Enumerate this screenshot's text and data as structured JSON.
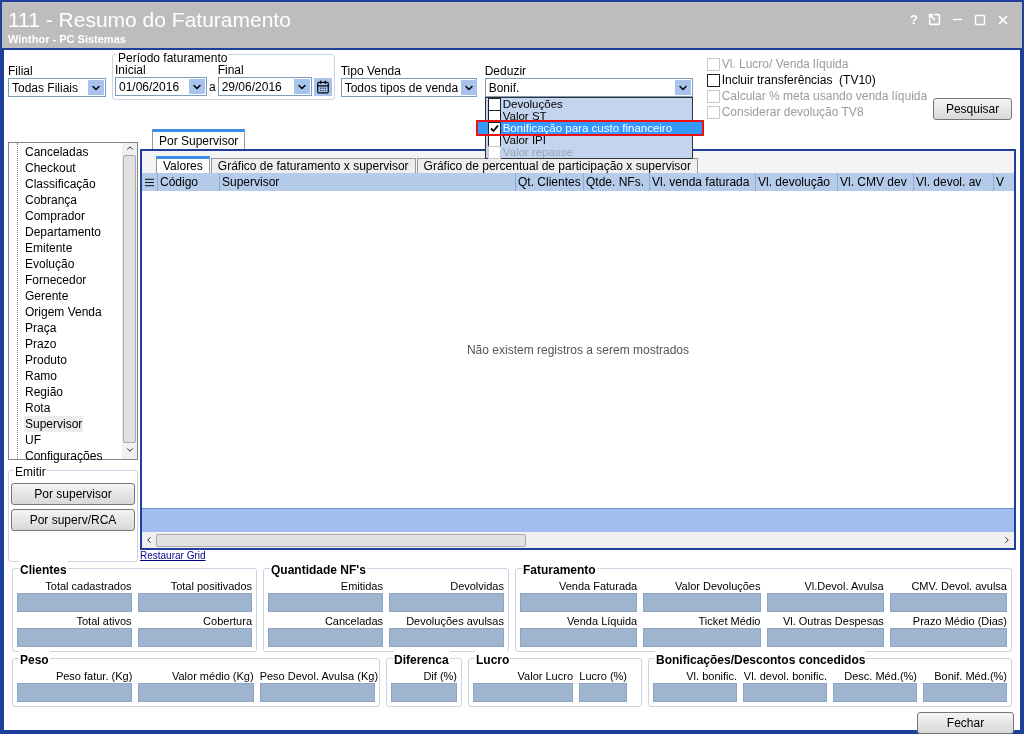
{
  "window": {
    "title": "111 - Resumo do Faturamento",
    "subtitle": "Winthor - PC Sistemas",
    "help": "?"
  },
  "filters": {
    "filial": {
      "label": "Filial",
      "value": "Todas Filiais"
    },
    "periodo": {
      "legend": "Período faturamento",
      "inicial_label": "Inicial",
      "inicial": "01/06/2016",
      "separator": "a",
      "final_label": "Final",
      "final": "29/06/2016"
    },
    "tipo_venda": {
      "label": "Tipo Venda",
      "value": "Todos tipos de venda"
    },
    "deduzir": {
      "label": "Deduzir",
      "value": "Bonif.",
      "options": [
        {
          "label": "Devoluções",
          "checked": false,
          "selected": false,
          "disabled": false
        },
        {
          "label": "Valor ST",
          "checked": false,
          "selected": false,
          "disabled": false
        },
        {
          "label": "Bonificação para custo financeiro",
          "checked": true,
          "selected": true,
          "disabled": false
        },
        {
          "label": "Valor IPI",
          "checked": false,
          "selected": false,
          "disabled": false
        },
        {
          "label": "Valor repasse",
          "checked": false,
          "selected": false,
          "disabled": true
        }
      ]
    }
  },
  "options": [
    {
      "label": "Vl. Lucro/ Venda líquida",
      "checked": false,
      "disabled": true
    },
    {
      "label": "Incluir transferências  (TV10)",
      "checked": false,
      "disabled": false
    },
    {
      "label": "Calcular % meta usando venda líquida",
      "checked": false,
      "disabled": true
    },
    {
      "label": "Considerar devolução TV8",
      "checked": false,
      "disabled": true
    }
  ],
  "search_button": "Pesquisar",
  "tree": {
    "items": [
      {
        "label": "Canceladas",
        "selected": false
      },
      {
        "label": "Checkout",
        "selected": false
      },
      {
        "label": "Classificação",
        "selected": false
      },
      {
        "label": "Cobrança",
        "selected": false
      },
      {
        "label": "Comprador",
        "selected": false
      },
      {
        "label": "Departamento",
        "selected": false
      },
      {
        "label": "Emitente",
        "selected": false
      },
      {
        "label": "Evolução",
        "selected": false
      },
      {
        "label": "Fornecedor",
        "selected": false
      },
      {
        "label": "Gerente",
        "selected": false
      },
      {
        "label": "Origem Venda",
        "selected": false
      },
      {
        "label": "Praça",
        "selected": false
      },
      {
        "label": "Prazo",
        "selected": false
      },
      {
        "label": "Produto",
        "selected": false
      },
      {
        "label": "Ramo",
        "selected": false
      },
      {
        "label": "Região",
        "selected": false
      },
      {
        "label": "Rota",
        "selected": false
      },
      {
        "label": "Supervisor",
        "selected": true
      },
      {
        "label": "UF",
        "selected": false
      },
      {
        "label": "Configurações",
        "selected": false
      }
    ]
  },
  "emitir": {
    "legend": "Emitir",
    "buttons": [
      "Por supervisor",
      "Por superv/RCA"
    ]
  },
  "outer_tabs": [
    {
      "label": "Por Supervisor",
      "selected": true
    }
  ],
  "inner_tabs": [
    {
      "label": "Valores",
      "selected": true
    },
    {
      "label": "Gráfico de faturamento x supervisor",
      "selected": false
    },
    {
      "label": "Gráfico de percentual de participação x supervisor",
      "selected": false
    }
  ],
  "grid": {
    "columns": [
      "Código",
      "Supervisor",
      "Qt. Clientes",
      "Qtde. NFs.",
      "Vl. venda faturada",
      "Vl. devolução",
      "Vl. CMV dev",
      "Vl. devol. av",
      "V"
    ],
    "empty_message": "Não existem registros a serem mostrados"
  },
  "restore_link": "Restaurar Grid",
  "summary_rows": [
    [
      {
        "title": "Clientes",
        "fields": [
          "Total cadastrados",
          "Total positivados",
          "Total ativos",
          "Cobertura"
        ]
      },
      {
        "title": "Quantidade NF's",
        "fields": [
          "Emitidas",
          "Devolvidas",
          "Canceladas",
          "Devoluções avulsas"
        ]
      },
      {
        "title": "Faturamento",
        "fields": [
          "Venda Faturada",
          "Valor Devoluções",
          "Vl.Devol. Avulsa",
          "CMV. Devol. avulsa",
          "Venda Líquida",
          "Ticket Médio",
          "Vl. Outras Despesas",
          "Prazo Médio (Dias)"
        ]
      }
    ],
    [
      {
        "title": "Peso",
        "fields": [
          "Peso fatur. (Kg)",
          "Valor médio (Kg)",
          "Peso Devol. Avulsa (Kg)"
        ]
      },
      {
        "title": "Diferenca",
        "fields": [
          "Dif (%)"
        ]
      },
      {
        "title": "Lucro",
        "fields": [
          "Valor Lucro",
          "Lucro (%)"
        ]
      },
      {
        "title": "Bonificações/Descontos concedidos",
        "fields": [
          "Vl. bonific.",
          "Vl. devol. bonific.",
          "Desc. Méd.(%)",
          "Bonif. Méd.(%)"
        ]
      }
    ]
  ],
  "close_button": "Fechar"
}
